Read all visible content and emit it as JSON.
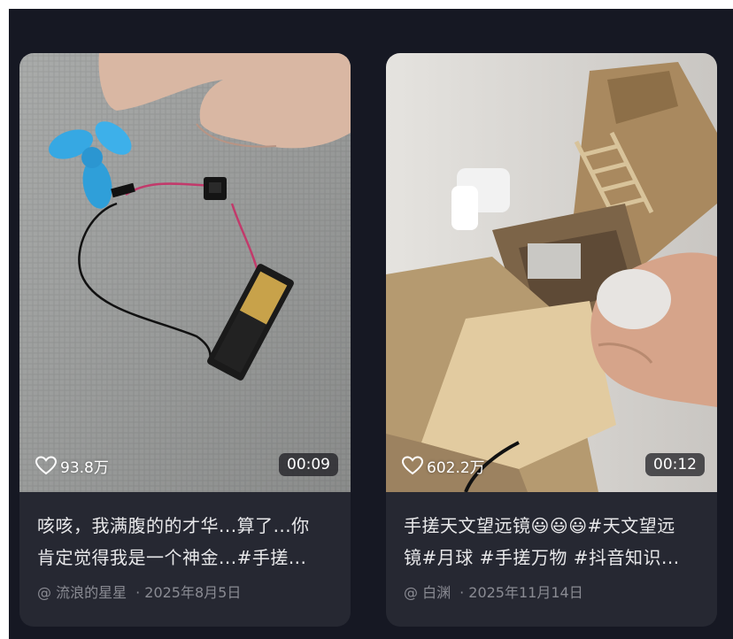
{
  "cards": [
    {
      "likes": "93.8万",
      "duration": "00:09",
      "caption_line1": "咳咳，我满腹的的才华...算了...你",
      "caption_line2": "肯定觉得我是一个神金...#手搓...",
      "author": "@ 流浪的星星",
      "date": "· 2025年8月5日",
      "thumbnail_desc": "blue fan, switch and AA battery circuit on gray fabric"
    },
    {
      "likes": "602.2万",
      "duration": "00:12",
      "caption_line1": "手搓天文望远镜😃😃😃#天文望远",
      "caption_line2": "镜#月球 #手搓万物 #抖音知识...",
      "author": "@ 白渊",
      "date": "· 2025年11月14日",
      "thumbnail_desc": "handmade cardboard telescope mount held in hand"
    }
  ],
  "colors": {
    "background": "#161823",
    "card": "#262832",
    "text": "#e8e8ea",
    "meta": "#8a8b93"
  },
  "icons": {
    "like": "heart-outline-icon"
  }
}
